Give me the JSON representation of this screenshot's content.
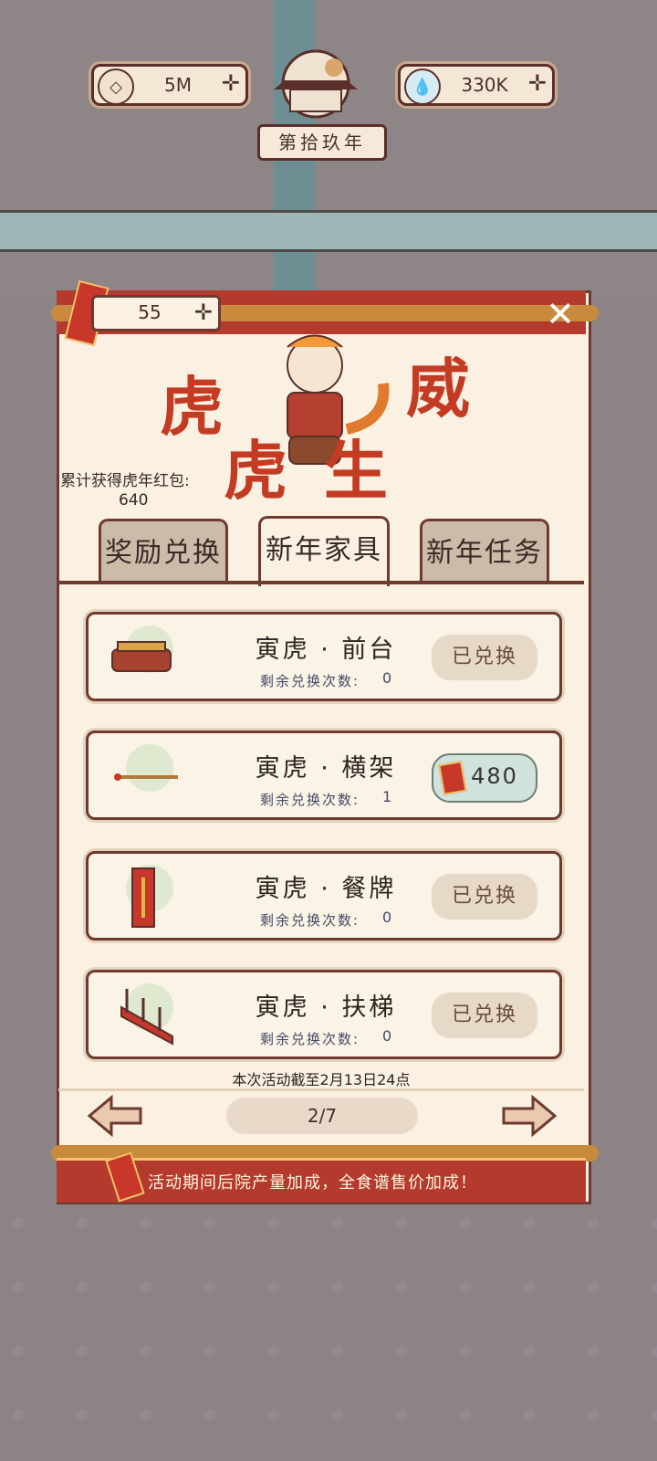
{
  "hud": {
    "coins": "5M",
    "water": "330K",
    "year_label": "第拾玖年",
    "coin_icon": "coin-icon",
    "water_icon": "water-drop-icon"
  },
  "event": {
    "envelope_count": "55",
    "title_art": "虎虎生威",
    "accum_label": "累计获得虎年红包:",
    "accum_value": "640"
  },
  "tabs": [
    {
      "label": "奖励兑换",
      "active": false
    },
    {
      "label": "新年家具",
      "active": true
    },
    {
      "label": "新年任务",
      "active": false
    }
  ],
  "items": [
    {
      "name": "寅虎 · 前台",
      "remain_label": "剩余兑换次数:",
      "remain": "0",
      "button": "已兑换",
      "icon": "front-desk-icon"
    },
    {
      "name": "寅虎 · 横架",
      "remain_label": "剩余兑换次数:",
      "remain": "1",
      "button": "480",
      "icon": "rack-icon"
    },
    {
      "name": "寅虎 · 餐牌",
      "remain_label": "剩余兑换次数:",
      "remain": "0",
      "button": "已兑换",
      "icon": "menu-sign-icon"
    },
    {
      "name": "寅虎 · 扶梯",
      "remain_label": "剩余兑换次数:",
      "remain": "0",
      "button": "已兑换",
      "icon": "staircase-icon"
    }
  ],
  "footer": {
    "deadline": "本次活动截至2月13日24点",
    "page": "2/7",
    "bonus": "活动期间后院产量加成，全食谱售价加成！"
  },
  "colors": {
    "accent_red": "#b33a2c",
    "panel_bg": "#fbf1e2",
    "border_brown": "#6e3a30"
  }
}
